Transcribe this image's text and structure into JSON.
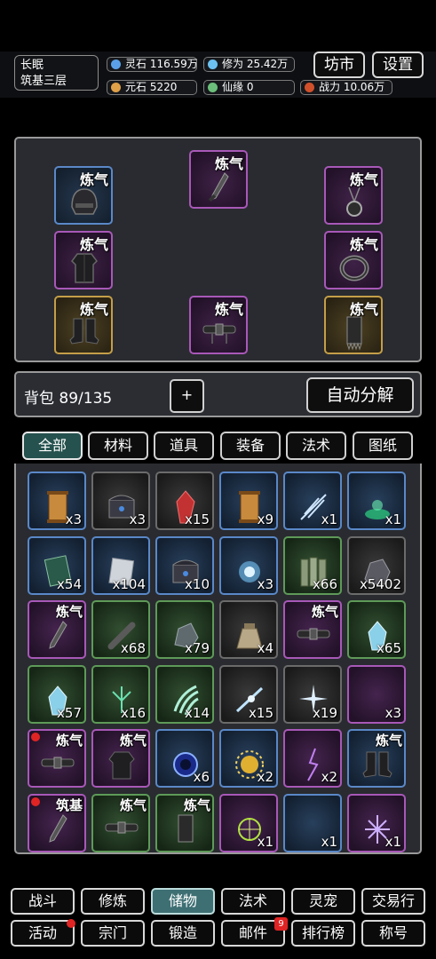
{
  "player": {
    "name": "长眠",
    "realm": "筑基三层"
  },
  "stats": {
    "lingshi": "灵石 116.59万",
    "xiuwei": "修为 25.42万",
    "yuanshi": "元石 5220",
    "xianyuan": "仙缘 0",
    "zhanli": "战力 10.06万"
  },
  "header_buttons": {
    "market": "坊市",
    "settings": "设置"
  },
  "equipment": {
    "slots": [
      {
        "tag": "炼气",
        "icon": "helmet-icon"
      },
      {
        "tag": "炼气",
        "icon": "sword-icon"
      },
      {
        "tag": "炼气",
        "icon": "amulet-icon"
      },
      {
        "tag": "炼气",
        "icon": "robe-icon"
      },
      {
        "tag": "炼气",
        "icon": "ring-icon"
      },
      {
        "tag": "炼气",
        "icon": "boots-icon"
      },
      {
        "tag": "炼气",
        "icon": "belt-icon"
      },
      {
        "tag": "炼气",
        "icon": "talisman-icon"
      }
    ]
  },
  "bag": {
    "label": "背包 89/135",
    "add": "+",
    "auto_decompose": "自动分解"
  },
  "filter_tabs": [
    "全部",
    "材料",
    "道具",
    "装备",
    "法术",
    "图纸"
  ],
  "inventory": [
    {
      "count": "x3",
      "tag": "",
      "icon": "scroll-icon",
      "dot": false
    },
    {
      "count": "x3",
      "tag": "",
      "icon": "chest-icon",
      "dot": false
    },
    {
      "count": "x15",
      "tag": "",
      "icon": "red-crystal-icon",
      "dot": false
    },
    {
      "count": "x9",
      "tag": "",
      "icon": "scroll-icon",
      "dot": false
    },
    {
      "count": "x1",
      "tag": "",
      "icon": "spell-icon",
      "dot": false
    },
    {
      "count": "x1",
      "tag": "",
      "icon": "portal-icon",
      "dot": false
    },
    {
      "count": "x54",
      "tag": "",
      "icon": "book-icon",
      "dot": false
    },
    {
      "count": "x104",
      "tag": "",
      "icon": "paper-icon",
      "dot": false
    },
    {
      "count": "x10",
      "tag": "",
      "icon": "chest-icon",
      "dot": false
    },
    {
      "count": "x3",
      "tag": "",
      "icon": "orb-icon",
      "dot": false
    },
    {
      "count": "x66",
      "tag": "",
      "icon": "bamboo-icon",
      "dot": false
    },
    {
      "count": "x5402",
      "tag": "",
      "icon": "ore-icon",
      "dot": false
    },
    {
      "count": "",
      "tag": "炼气",
      "icon": "sword-icon",
      "dot": false
    },
    {
      "count": "x68",
      "tag": "",
      "icon": "bone-icon",
      "dot": false
    },
    {
      "count": "x79",
      "tag": "",
      "icon": "rock-icon",
      "dot": false
    },
    {
      "count": "x4",
      "tag": "",
      "icon": "sack-icon",
      "dot": false
    },
    {
      "count": "",
      "tag": "炼气",
      "icon": "belt-icon",
      "dot": false
    },
    {
      "count": "x65",
      "tag": "",
      "icon": "crystal-icon",
      "dot": false
    },
    {
      "count": "x57",
      "tag": "",
      "icon": "crystal-icon",
      "dot": false
    },
    {
      "count": "x16",
      "tag": "",
      "icon": "herb-icon",
      "dot": false
    },
    {
      "count": "x14",
      "tag": "",
      "icon": "claw-icon",
      "dot": false
    },
    {
      "count": "x15",
      "tag": "",
      "icon": "ice-spell-icon",
      "dot": false
    },
    {
      "count": "x19",
      "tag": "",
      "icon": "star-spell-icon",
      "dot": false
    },
    {
      "count": "x3",
      "tag": "",
      "icon": "moon-icon",
      "dot": false
    },
    {
      "count": "",
      "tag": "炼气",
      "icon": "belt-icon",
      "dot": true
    },
    {
      "count": "",
      "tag": "炼气",
      "icon": "robe-icon",
      "dot": false
    },
    {
      "count": "x6",
      "tag": "",
      "icon": "vortex-icon",
      "dot": false
    },
    {
      "count": "x2",
      "tag": "",
      "icon": "sun-icon",
      "dot": false
    },
    {
      "count": "x2",
      "tag": "",
      "icon": "lightning-icon",
      "dot": false
    },
    {
      "count": "",
      "tag": "炼气",
      "icon": "boots-icon",
      "dot": false
    },
    {
      "count": "",
      "tag": "筑基",
      "icon": "sword-icon",
      "dot": true
    },
    {
      "count": "",
      "tag": "炼气",
      "icon": "belt-icon",
      "dot": false
    },
    {
      "count": "",
      "tag": "炼气",
      "icon": "talisman-icon",
      "dot": false
    },
    {
      "count": "x1",
      "tag": "",
      "icon": "rune-icon",
      "dot": false
    },
    {
      "count": "x1",
      "tag": "",
      "icon": "moon-icon",
      "dot": false
    },
    {
      "count": "x1",
      "tag": "",
      "icon": "frost-icon",
      "dot": false
    }
  ],
  "nav": {
    "row1": [
      "战斗",
      "修炼",
      "储物",
      "法术",
      "灵宠",
      "交易行"
    ],
    "row2": [
      "活动",
      "宗门",
      "锻造",
      "邮件",
      "排行榜",
      "称号"
    ],
    "mail_badge": "9"
  },
  "colors": {
    "accent": "#3d6f73",
    "active_tab": "#25524e",
    "badge": "#e02424"
  }
}
